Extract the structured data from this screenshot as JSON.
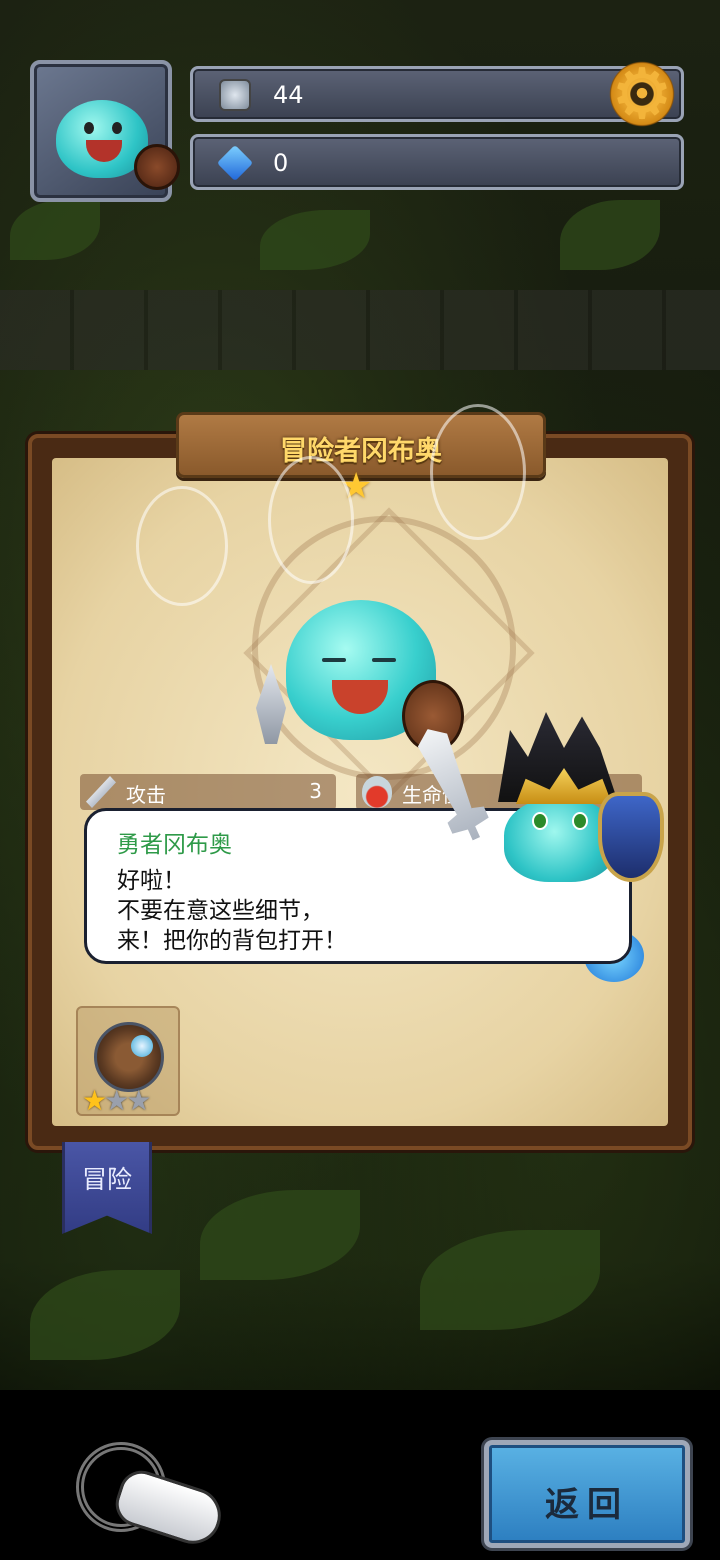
{
  "hud": {
    "coins": "44",
    "gems": "0",
    "coin_icon": "silver-coin-icon",
    "gem_icon": "blue-gem-icon",
    "settings_icon": "gear-icon"
  },
  "hero_panel": {
    "hero_name": "冒险者冈布奥",
    "rank_stars": 1,
    "stats": [
      {
        "label": "攻击",
        "value": "3",
        "icon": "sword-icon"
      },
      {
        "label": "生命值",
        "value": "",
        "icon": "potion-icon"
      }
    ]
  },
  "dialog": {
    "speaker": "勇者冈布奥",
    "lines": [
      "好啦！",
      "不要在意这些细节，",
      "来！把你的背包打开！"
    ]
  },
  "item": {
    "icon": "spyglass-icon",
    "stars_filled": 1,
    "stars_total": 3
  },
  "tabs": {
    "adventure": "冒险"
  },
  "buttons": {
    "return": "返回"
  },
  "colors": {
    "title_gold": "#ffd86a",
    "speaker_green": "#2e9a48",
    "star_gold": "#ffc21a",
    "return_blue": "#3f98d4"
  }
}
